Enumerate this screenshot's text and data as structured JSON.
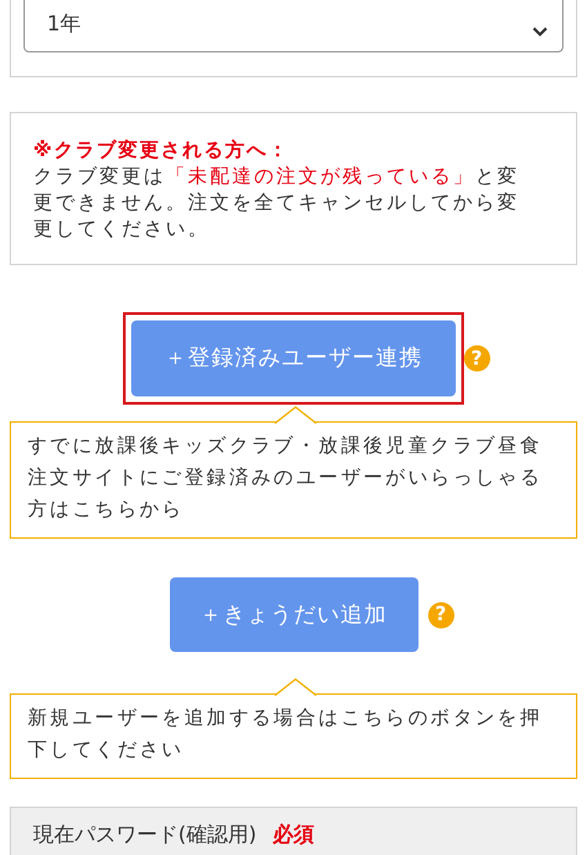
{
  "grade_select": {
    "value": "1年"
  },
  "notice": {
    "title": "※クラブ変更される方へ：",
    "body": [
      {
        "kind": "normal",
        "text": "クラブ変更は"
      },
      {
        "kind": "emphasis",
        "text": "「未配達の注文が残っている」"
      },
      {
        "kind": "normal",
        "text": "と変更できません。注文を全てキャンセルしてから変更してください。"
      }
    ]
  },
  "actions": [
    {
      "label": "＋登録済みユーザー連携",
      "highlighted": true,
      "help": "?",
      "tooltip": "すでに放課後キッズクラブ・放課後児童クラブ昼食注文サイトにご登録済みのユーザーがいらっしゃる方はこちらから"
    },
    {
      "label": "＋きょうだい追加",
      "highlighted": false,
      "help": "?",
      "tooltip": "新規ユーザーを追加する場合はこちらのボタンを押下してください"
    }
  ],
  "password_section": {
    "label": "現在パスワード(確認用)",
    "required": "必須"
  }
}
